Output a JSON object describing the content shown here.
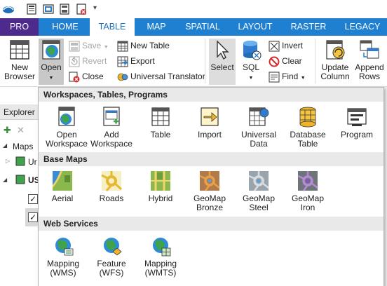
{
  "tabs": [
    {
      "key": "pro",
      "label": "PRO"
    },
    {
      "key": "home",
      "label": "HOME"
    },
    {
      "key": "table",
      "label": "TABLE"
    },
    {
      "key": "map",
      "label": "MAP"
    },
    {
      "key": "spatial",
      "label": "SPATIAL"
    },
    {
      "key": "layout",
      "label": "LAYOUT"
    },
    {
      "key": "raster",
      "label": "RASTER"
    },
    {
      "key": "legacy",
      "label": "LEGACY"
    }
  ],
  "active_tab": "TABLE",
  "ribbon": {
    "new_browser_line1": "New",
    "new_browser_line2": "Browser",
    "open": "Open",
    "save": "Save",
    "revert": "Revert",
    "close": "Close",
    "new_table": "New Table",
    "export": "Export",
    "universal_translator": "Universal Translator",
    "select": "Select",
    "sql": "SQL",
    "invert": "Invert",
    "clear": "Clear",
    "find": "Find",
    "update_line1": "Update",
    "update_line2": "Column",
    "append_line1": "Append",
    "append_line2": "Rows"
  },
  "left_pane": {
    "explorer": "Explorer",
    "maps": "Maps",
    "item1": "Ur",
    "item2": "US"
  },
  "gallery": {
    "sections": {
      "workspaces": "Workspaces, Tables, Programs",
      "base_maps": "Base Maps",
      "web_services": "Web Services"
    },
    "workspaces_items": [
      {
        "line1": "Open",
        "line2": "Workspace",
        "icon": "open-workspace-icon"
      },
      {
        "line1": "Add",
        "line2": "Workspace",
        "icon": "add-workspace-icon"
      },
      {
        "line1": "Table",
        "line2": "",
        "icon": "table-icon"
      },
      {
        "line1": "Import",
        "line2": "",
        "icon": "import-icon"
      },
      {
        "line1": "Universal",
        "line2": "Data",
        "icon": "universal-data-icon"
      },
      {
        "line1": "Database",
        "line2": "Table",
        "icon": "database-table-icon"
      },
      {
        "line1": "Program",
        "line2": "",
        "icon": "program-icon"
      }
    ],
    "base_map_items": [
      {
        "line1": "Aerial",
        "line2": "",
        "icon": "aerial-map-icon"
      },
      {
        "line1": "Roads",
        "line2": "",
        "icon": "roads-map-icon"
      },
      {
        "line1": "Hybrid",
        "line2": "",
        "icon": "hybrid-map-icon"
      },
      {
        "line1": "GeoMap",
        "line2": "Bronze",
        "icon": "geomap-bronze-icon"
      },
      {
        "line1": "GeoMap",
        "line2": "Steel",
        "icon": "geomap-steel-icon"
      },
      {
        "line1": "GeoMap",
        "line2": "Iron",
        "icon": "geomap-iron-icon"
      }
    ],
    "web_service_items": [
      {
        "line1": "Mapping",
        "line2": "(WMS)",
        "icon": "wms-icon"
      },
      {
        "line1": "Feature",
        "line2": "(WFS)",
        "icon": "wfs-icon"
      },
      {
        "line1": "Mapping",
        "line2": "(WMTS)",
        "icon": "wmts-icon"
      }
    ]
  },
  "colors": {
    "tab_bar": "#1f7fd0",
    "pro_tab": "#4d2a8c",
    "section_header": "#e9e9e9"
  }
}
